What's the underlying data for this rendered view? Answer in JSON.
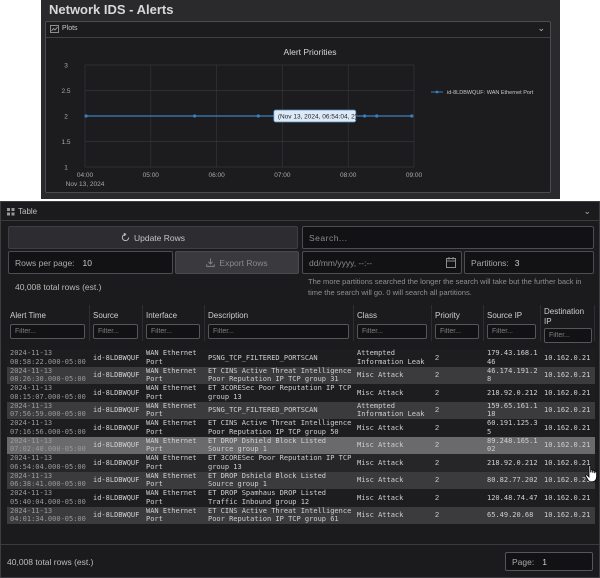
{
  "page_title": "Network IDS - Alerts",
  "plots": {
    "title": "Plots",
    "icon": "chart-icon",
    "chart_data": {
      "type": "line",
      "title": "Alert Priorities",
      "series": [
        {
          "name": "id-8LDBWQUF: WAN Ethernet Port",
          "color": "#3a7fc0",
          "x": [
            "2024-11-13T04:01",
            "2024-11-13T05:40",
            "2024-11-13T06:38",
            "2024-11-13T06:54",
            "2024-11-13T07:02",
            "2024-11-13T07:16",
            "2024-11-13T07:56",
            "2024-11-13T08:15",
            "2024-11-13T08:26",
            "2024-11-13T08:58"
          ],
          "y": [
            2,
            2,
            2,
            2,
            2,
            2,
            2,
            2,
            2,
            2
          ]
        }
      ],
      "xticks": [
        "04:00",
        "05:00",
        "06:00",
        "07:00",
        "08:00",
        "09:00"
      ],
      "xtick_sublabel": "Nov 13, 2024",
      "yticks": [
        "1",
        "1.5",
        "2",
        "2.5",
        "3"
      ],
      "ylim": [
        1,
        3
      ],
      "xlim": [
        "2024-11-13T04:00",
        "2024-11-13T09:00"
      ],
      "grid": true,
      "legend": "top-right",
      "tooltip": "(Nov 13, 2024, 06:54:04, 2)"
    }
  },
  "table": {
    "title": "Table",
    "update_label": "Update Rows",
    "search_placeholder": "Search...",
    "rows_per_page_label": "Rows per page:",
    "rows_per_page_value": "10",
    "export_label": "Export Rows",
    "date_placeholder": "dd/mm/yyyy, --:--",
    "partitions_label": "Partitions:",
    "partitions_value": "3",
    "total_rows": "40,008 total rows (est.)",
    "partition_help": "The more partitions searched the longer the search will take but the further back in time the search will go. 0 will search all partitions.",
    "filter_placeholder": "Filter...",
    "columns": [
      "Alert Time",
      "Source",
      "Interface",
      "Description",
      "Class",
      "Priority",
      "Source IP",
      "Destination IP"
    ],
    "field_names": [
      "event-second",
      "sensor-id",
      "sensor-interface",
      "msg",
      "classification",
      "priority",
      "source-ip",
      "destination-ip"
    ],
    "rows": [
      [
        "2024-11-13\n08:58:22.000-05:00",
        "id-8LDBWQUF",
        "WAN Ethernet\nPort",
        "PSNG_TCP_FILTERED_PORTSCAN",
        "Attempted\nInformation Leak",
        "2",
        "179.43.168.1\n46",
        "10.162.0.21"
      ],
      [
        "2024-11-13\n08:26:30.000-05:00",
        "id-8LDBWQUF",
        "WAN Ethernet\nPort",
        "ET CINS Active Threat Intelligence\nPoor Reputation IP TCP group 31",
        "Misc Attack",
        "2",
        "46.174.191.2\n8",
        "10.162.0.21"
      ],
      [
        "2024-11-13\n08:15:07.000-05:00",
        "id-8LDBWQUF",
        "WAN Ethernet\nPort",
        "ET 3CORESec Poor Reputation IP TCP\ngroup 13",
        "Misc Attack",
        "2",
        "218.92.0.212",
        "10.162.0.21"
      ],
      [
        "2024-11-13\n07:56:59.000-05:00",
        "id-8LDBWQUF",
        "WAN Ethernet\nPort",
        "PSNG_TCP_FILTERED_PORTSCAN",
        "Attempted\nInformation Leak",
        "2",
        "159.65.161.1\n18",
        "10.162.0.21"
      ],
      [
        "2024-11-13\n07:16:56.000-05:00",
        "id-8LDBWQUF",
        "WAN Ethernet\nPort",
        "ET CINS Active Threat Intelligence\nPoor Reputation IP TCP group 50",
        "Misc Attack",
        "2",
        "60.191.125.3\n5",
        "10.162.0.21"
      ],
      [
        "2024-11-13\n07:02:40.000-05:00",
        "id-8LDBWQUF",
        "WAN Ethernet\nPort",
        "ET DROP Dshield Block Listed\nSource group 1",
        "Misc Attack",
        "2",
        "89.248.165.1\n02",
        "10.162.0.21"
      ],
      [
        "2024-11-13\n06:54:04.000-05:00",
        "id-8LDBWQUF",
        "WAN Ethernet\nPort",
        "ET 3CORESec Poor Reputation IP TCP\ngroup 13",
        "Misc Attack",
        "2",
        "218.92.0.212",
        "10.162.0.21"
      ],
      [
        "2024-11-13\n06:38:41.000-05:00",
        "id-8LDBWQUF",
        "WAN Ethernet\nPort",
        "ET DROP Dshield Block Listed\nSource group 1",
        "Misc Attack",
        "2",
        "80.82.77.202",
        "10.162.0.21"
      ],
      [
        "2024-11-13\n05:40:04.000-05:00",
        "id-8LDBWQUF",
        "WAN Ethernet\nPort",
        "ET DROP Spamhaus DROP Listed\nTraffic Inbound group 12",
        "Misc Attack",
        "2",
        "120.48.74.47",
        "10.162.0.21"
      ],
      [
        "2024-11-13\n04:01:34.000-05:00",
        "id-8LDBWQUF",
        "WAN Ethernet\nPort",
        "ET CINS Active Threat Intelligence\nPoor Reputation IP TCP group 61",
        "Misc Attack",
        "2",
        "65.49.20.68",
        "10.162.0.21"
      ]
    ],
    "page_label": "Page:",
    "page_value": "1"
  },
  "colors": {
    "row_even": "#1d1d20",
    "row_odd": "#3b3b3e",
    "row_highlight": "#6a6a6d",
    "row_hover": "#262629",
    "accent_line": "#3a7fc0"
  }
}
